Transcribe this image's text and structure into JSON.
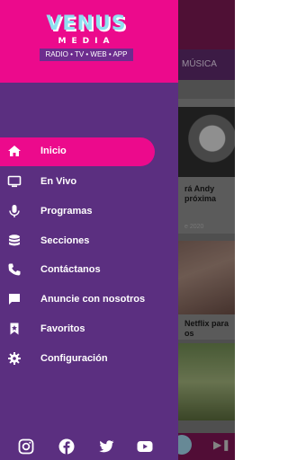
{
  "brand": {
    "logo_main": "VENUS",
    "logo_sub": "MEDIA",
    "tagline": "RADIO • TV • WEB • APP"
  },
  "background": {
    "tab_label": "MÚSICA",
    "article_1_text": "rá Andy\npróxima",
    "article_1_date": "e 2020",
    "article_2_text": "Netflix para\nos"
  },
  "nav": {
    "items": [
      {
        "label": "Inicio",
        "icon": "home-icon",
        "active": true
      },
      {
        "label": "En Vivo",
        "icon": "tv-icon",
        "active": false
      },
      {
        "label": "Programas",
        "icon": "microphone-icon",
        "active": false
      },
      {
        "label": "Secciones",
        "icon": "database-icon",
        "active": false
      },
      {
        "label": "Contáctanos",
        "icon": "phone-icon",
        "active": false
      },
      {
        "label": "Anuncie con nosotros",
        "icon": "chat-icon",
        "active": false
      },
      {
        "label": "Favoritos",
        "icon": "bookmark-icon",
        "active": false
      },
      {
        "label": "Configuración",
        "icon": "gear-icon",
        "active": false
      }
    ]
  },
  "social": [
    "instagram-icon",
    "facebook-icon",
    "twitter-icon",
    "youtube-icon"
  ],
  "colors": {
    "header_pink": "#ec0a8c",
    "drawer_purple": "#5b2f80",
    "accent_cyan": "#8fe0f0"
  }
}
